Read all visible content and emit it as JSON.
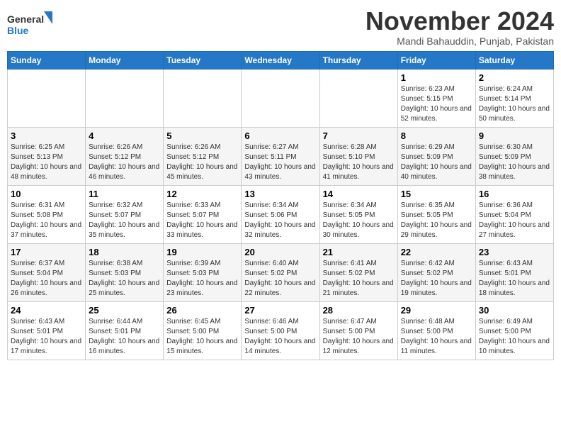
{
  "header": {
    "logo_line1": "General",
    "logo_line2": "Blue",
    "month_title": "November 2024",
    "subtitle": "Mandi Bahauddin, Punjab, Pakistan"
  },
  "weekdays": [
    "Sunday",
    "Monday",
    "Tuesday",
    "Wednesday",
    "Thursday",
    "Friday",
    "Saturday"
  ],
  "weeks": [
    [
      {
        "day": "",
        "info": ""
      },
      {
        "day": "",
        "info": ""
      },
      {
        "day": "",
        "info": ""
      },
      {
        "day": "",
        "info": ""
      },
      {
        "day": "",
        "info": ""
      },
      {
        "day": "1",
        "info": "Sunrise: 6:23 AM\nSunset: 5:15 PM\nDaylight: 10 hours and 52 minutes."
      },
      {
        "day": "2",
        "info": "Sunrise: 6:24 AM\nSunset: 5:14 PM\nDaylight: 10 hours and 50 minutes."
      }
    ],
    [
      {
        "day": "3",
        "info": "Sunrise: 6:25 AM\nSunset: 5:13 PM\nDaylight: 10 hours and 48 minutes."
      },
      {
        "day": "4",
        "info": "Sunrise: 6:26 AM\nSunset: 5:12 PM\nDaylight: 10 hours and 46 minutes."
      },
      {
        "day": "5",
        "info": "Sunrise: 6:26 AM\nSunset: 5:12 PM\nDaylight: 10 hours and 45 minutes."
      },
      {
        "day": "6",
        "info": "Sunrise: 6:27 AM\nSunset: 5:11 PM\nDaylight: 10 hours and 43 minutes."
      },
      {
        "day": "7",
        "info": "Sunrise: 6:28 AM\nSunset: 5:10 PM\nDaylight: 10 hours and 41 minutes."
      },
      {
        "day": "8",
        "info": "Sunrise: 6:29 AM\nSunset: 5:09 PM\nDaylight: 10 hours and 40 minutes."
      },
      {
        "day": "9",
        "info": "Sunrise: 6:30 AM\nSunset: 5:09 PM\nDaylight: 10 hours and 38 minutes."
      }
    ],
    [
      {
        "day": "10",
        "info": "Sunrise: 6:31 AM\nSunset: 5:08 PM\nDaylight: 10 hours and 37 minutes."
      },
      {
        "day": "11",
        "info": "Sunrise: 6:32 AM\nSunset: 5:07 PM\nDaylight: 10 hours and 35 minutes."
      },
      {
        "day": "12",
        "info": "Sunrise: 6:33 AM\nSunset: 5:07 PM\nDaylight: 10 hours and 33 minutes."
      },
      {
        "day": "13",
        "info": "Sunrise: 6:34 AM\nSunset: 5:06 PM\nDaylight: 10 hours and 32 minutes."
      },
      {
        "day": "14",
        "info": "Sunrise: 6:34 AM\nSunset: 5:05 PM\nDaylight: 10 hours and 30 minutes."
      },
      {
        "day": "15",
        "info": "Sunrise: 6:35 AM\nSunset: 5:05 PM\nDaylight: 10 hours and 29 minutes."
      },
      {
        "day": "16",
        "info": "Sunrise: 6:36 AM\nSunset: 5:04 PM\nDaylight: 10 hours and 27 minutes."
      }
    ],
    [
      {
        "day": "17",
        "info": "Sunrise: 6:37 AM\nSunset: 5:04 PM\nDaylight: 10 hours and 26 minutes."
      },
      {
        "day": "18",
        "info": "Sunrise: 6:38 AM\nSunset: 5:03 PM\nDaylight: 10 hours and 25 minutes."
      },
      {
        "day": "19",
        "info": "Sunrise: 6:39 AM\nSunset: 5:03 PM\nDaylight: 10 hours and 23 minutes."
      },
      {
        "day": "20",
        "info": "Sunrise: 6:40 AM\nSunset: 5:02 PM\nDaylight: 10 hours and 22 minutes."
      },
      {
        "day": "21",
        "info": "Sunrise: 6:41 AM\nSunset: 5:02 PM\nDaylight: 10 hours and 21 minutes."
      },
      {
        "day": "22",
        "info": "Sunrise: 6:42 AM\nSunset: 5:02 PM\nDaylight: 10 hours and 19 minutes."
      },
      {
        "day": "23",
        "info": "Sunrise: 6:43 AM\nSunset: 5:01 PM\nDaylight: 10 hours and 18 minutes."
      }
    ],
    [
      {
        "day": "24",
        "info": "Sunrise: 6:43 AM\nSunset: 5:01 PM\nDaylight: 10 hours and 17 minutes."
      },
      {
        "day": "25",
        "info": "Sunrise: 6:44 AM\nSunset: 5:01 PM\nDaylight: 10 hours and 16 minutes."
      },
      {
        "day": "26",
        "info": "Sunrise: 6:45 AM\nSunset: 5:00 PM\nDaylight: 10 hours and 15 minutes."
      },
      {
        "day": "27",
        "info": "Sunrise: 6:46 AM\nSunset: 5:00 PM\nDaylight: 10 hours and 14 minutes."
      },
      {
        "day": "28",
        "info": "Sunrise: 6:47 AM\nSunset: 5:00 PM\nDaylight: 10 hours and 12 minutes."
      },
      {
        "day": "29",
        "info": "Sunrise: 6:48 AM\nSunset: 5:00 PM\nDaylight: 10 hours and 11 minutes."
      },
      {
        "day": "30",
        "info": "Sunrise: 6:49 AM\nSunset: 5:00 PM\nDaylight: 10 hours and 10 minutes."
      }
    ]
  ]
}
